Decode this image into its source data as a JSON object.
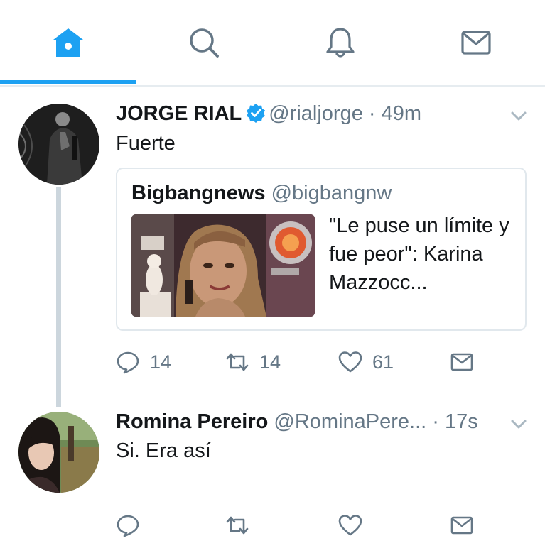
{
  "nav": {
    "tabs": [
      {
        "icon": "home-icon",
        "active": true
      },
      {
        "icon": "search-icon",
        "active": false
      },
      {
        "icon": "notifications-bell-icon",
        "active": false
      },
      {
        "icon": "messages-envelope-icon",
        "active": false
      }
    ],
    "accent_color": "#1da1f2"
  },
  "tweets": [
    {
      "name": "JORGE RIAL",
      "verified": true,
      "handle": "@rialjorge",
      "separator": "·",
      "time": "49m",
      "text": "Fuerte",
      "quoted": {
        "name": "Bigbangnews",
        "handle": "@bigbangnw",
        "text": "\"Le puse un límite y fue peor\": Karina Mazzocc..."
      },
      "actions": {
        "replies": "14",
        "retweets": "14",
        "likes": "61"
      }
    },
    {
      "name": "Romina Pereiro",
      "handle": "@RominaPere...",
      "separator": "·",
      "time": "17s",
      "text": "Si. Era así",
      "actions": {
        "replies": "",
        "retweets": "",
        "likes": ""
      }
    }
  ]
}
